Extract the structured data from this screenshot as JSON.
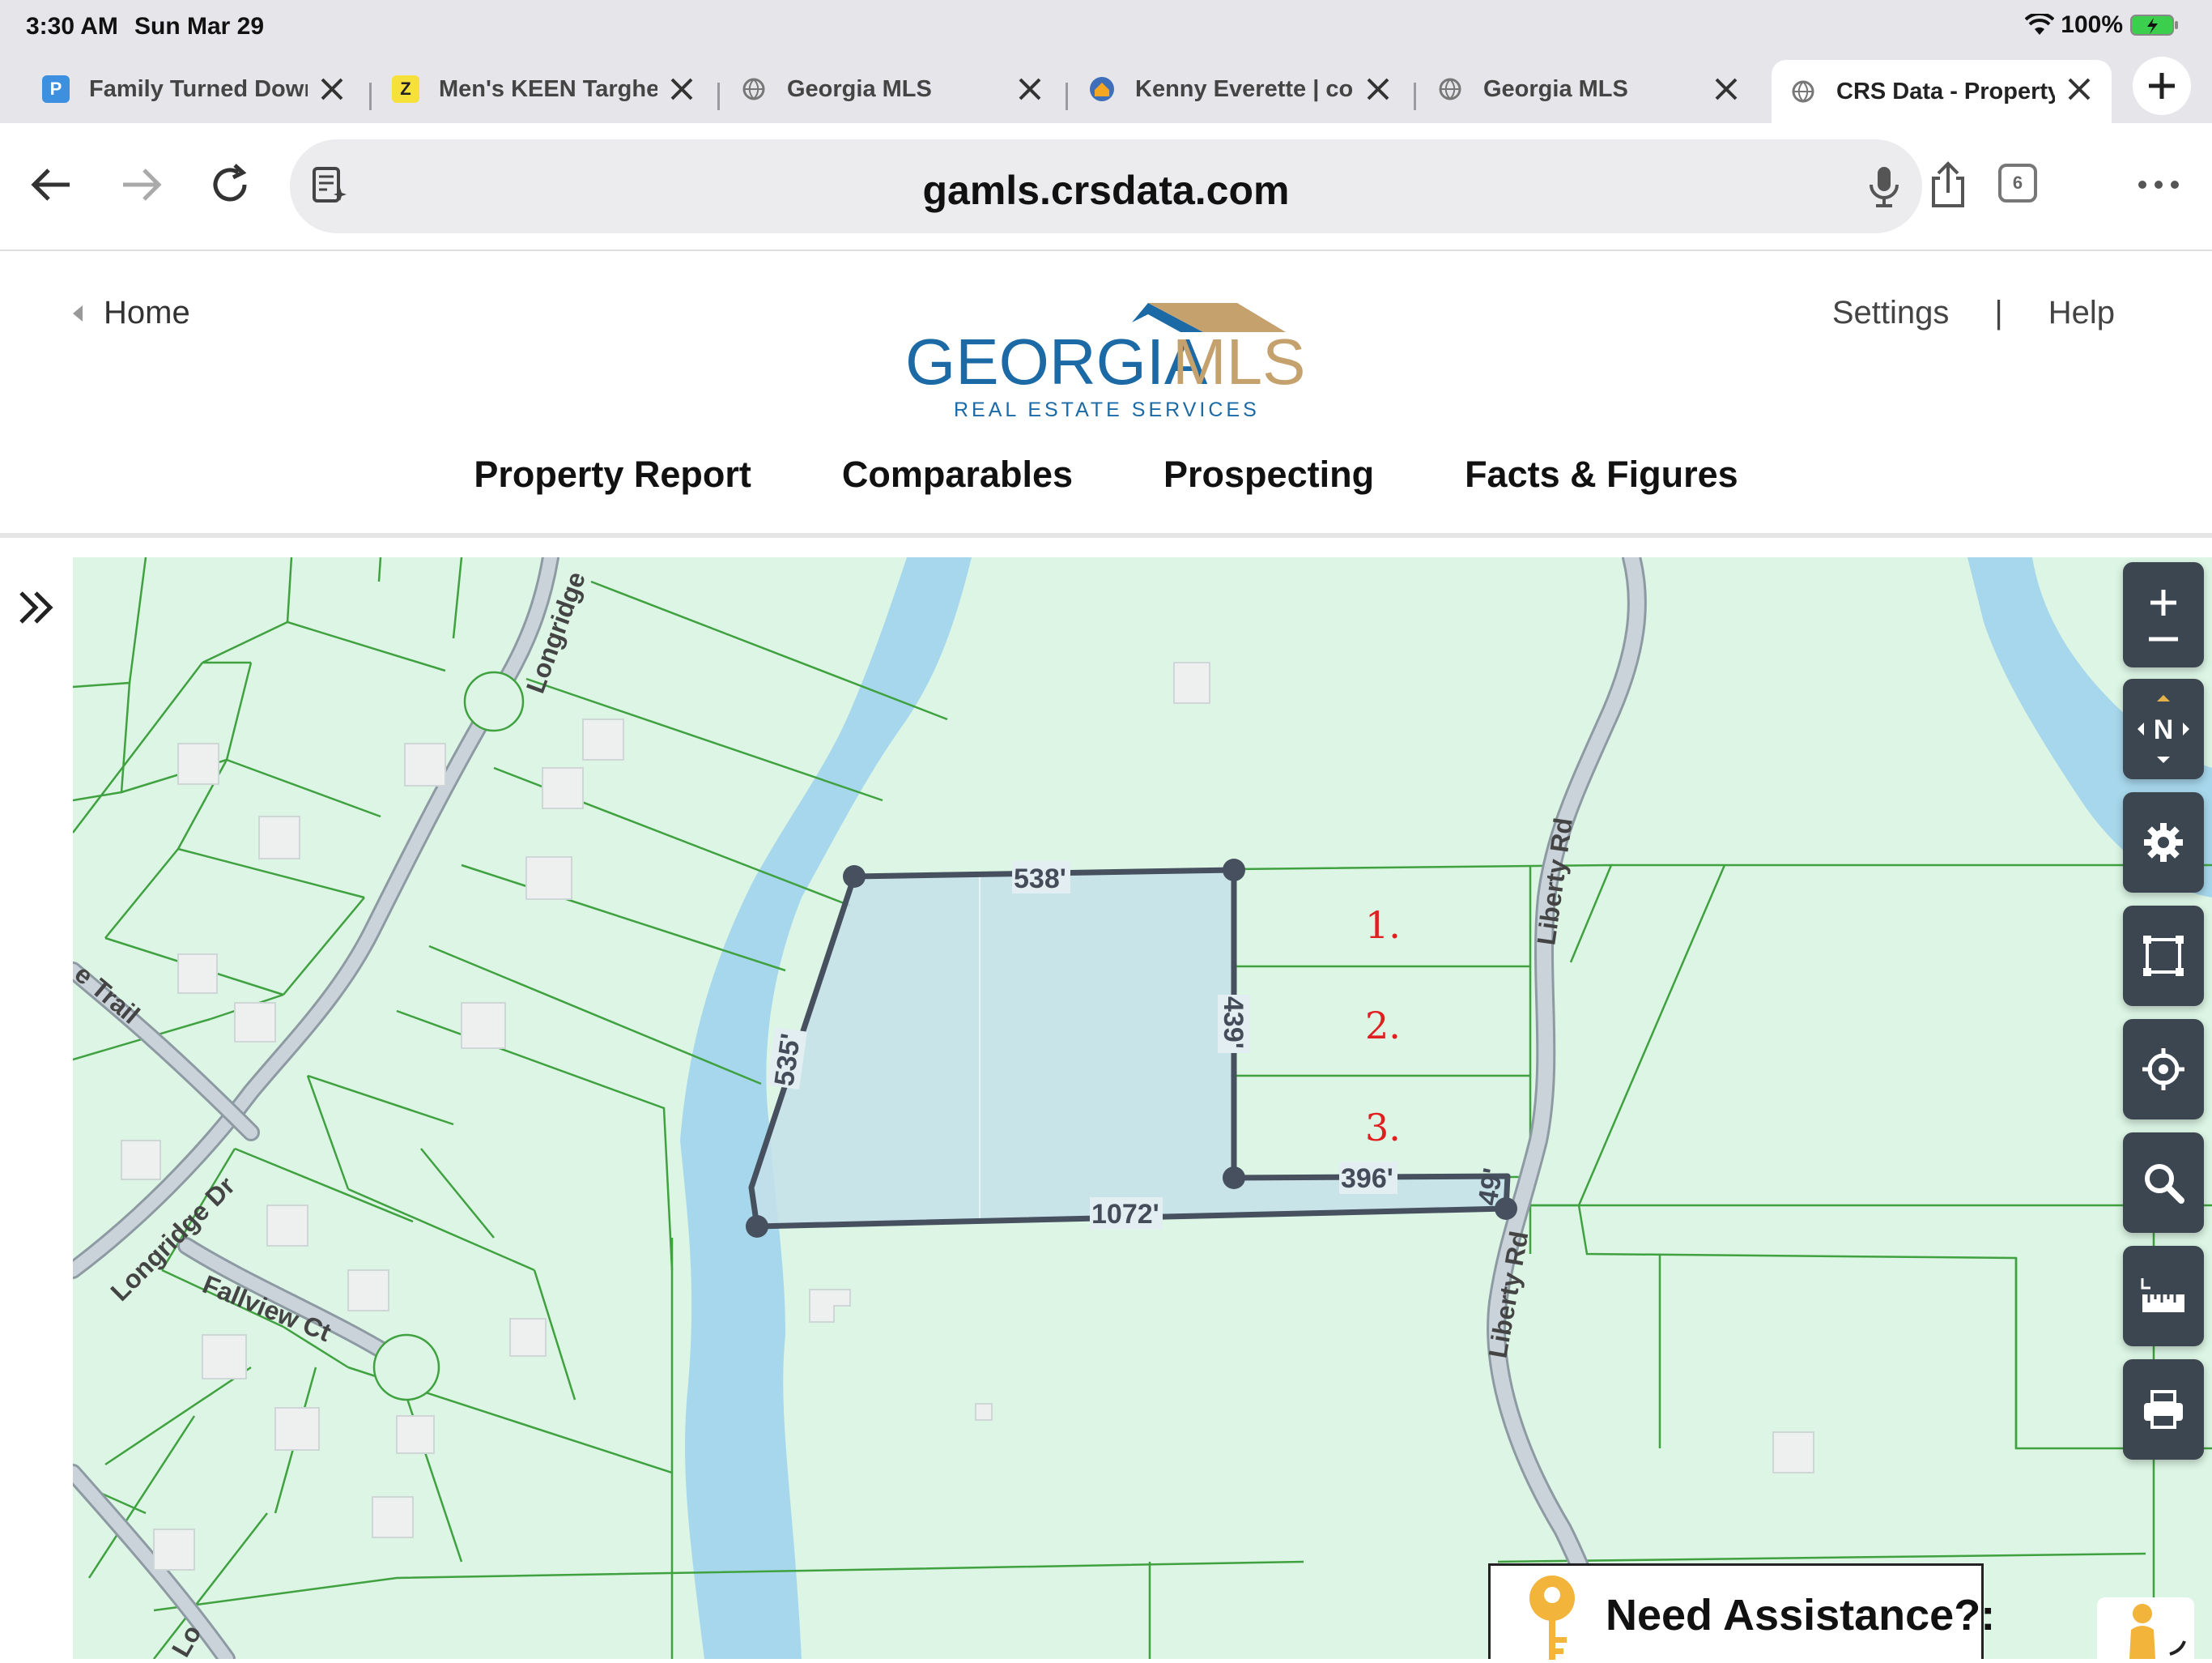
{
  "status_bar": {
    "time": "3:30 AM",
    "date": "Sun Mar 29",
    "battery": "100%"
  },
  "tabs": [
    {
      "title": "Family Turned Down",
      "favicon": "P",
      "favicon_color": "#3d8fe0"
    },
    {
      "title": "Men's KEEN Targhee",
      "favicon": "Z",
      "favicon_color": "#f6e13a"
    },
    {
      "title": "Georgia MLS",
      "favicon": "globe-icon"
    },
    {
      "title": "Kenny Everette | co",
      "favicon": "house-icon"
    },
    {
      "title": "Georgia MLS",
      "favicon": "globe-icon"
    },
    {
      "title": "CRS Data - Property",
      "favicon": "globe-icon",
      "active": true
    }
  ],
  "toolbar": {
    "url": "gamls.crsdata.com",
    "tab_count": "6"
  },
  "header": {
    "home": "Home",
    "settings": "Settings",
    "separator": "|",
    "help": "Help",
    "logo_word_1": "GEORGIA",
    "logo_word_2": "MLS",
    "logo_tagline": "REAL ESTATE SERVICES",
    "nav": [
      "Property Report",
      "Comparables",
      "Prospecting",
      "Facts & Figures"
    ]
  },
  "colors": {
    "map_land": "#dcf5e4",
    "parcel_line": "#3fa13f",
    "water": "#a7d7ec",
    "road": "#c9d3d9",
    "selected_fill": "#c5e0ea",
    "selected_outline": "#46505e",
    "control_bg": "#3c4650",
    "logo_blue": "#1b6aa5",
    "logo_tan": "#c5a16e"
  },
  "map": {
    "measurements": [
      "538'",
      "535'",
      "439'",
      "396'",
      "49'",
      "1072'"
    ],
    "roads": [
      "Longridge",
      "Longridge Dr",
      "Liberty Rd",
      "Liberty Rd",
      "Fallview Ct",
      "e Trail",
      "Lo"
    ],
    "annotations": [
      "1.",
      "2.",
      "3."
    ]
  },
  "map_controls": [
    "zoom-in",
    "zoom-out",
    "compass-north",
    "settings",
    "select-area",
    "locate",
    "search",
    "measure",
    "print"
  ],
  "compass_label": "N",
  "assistance": {
    "label": "Need Assistance?",
    "menu_dots": ":"
  }
}
